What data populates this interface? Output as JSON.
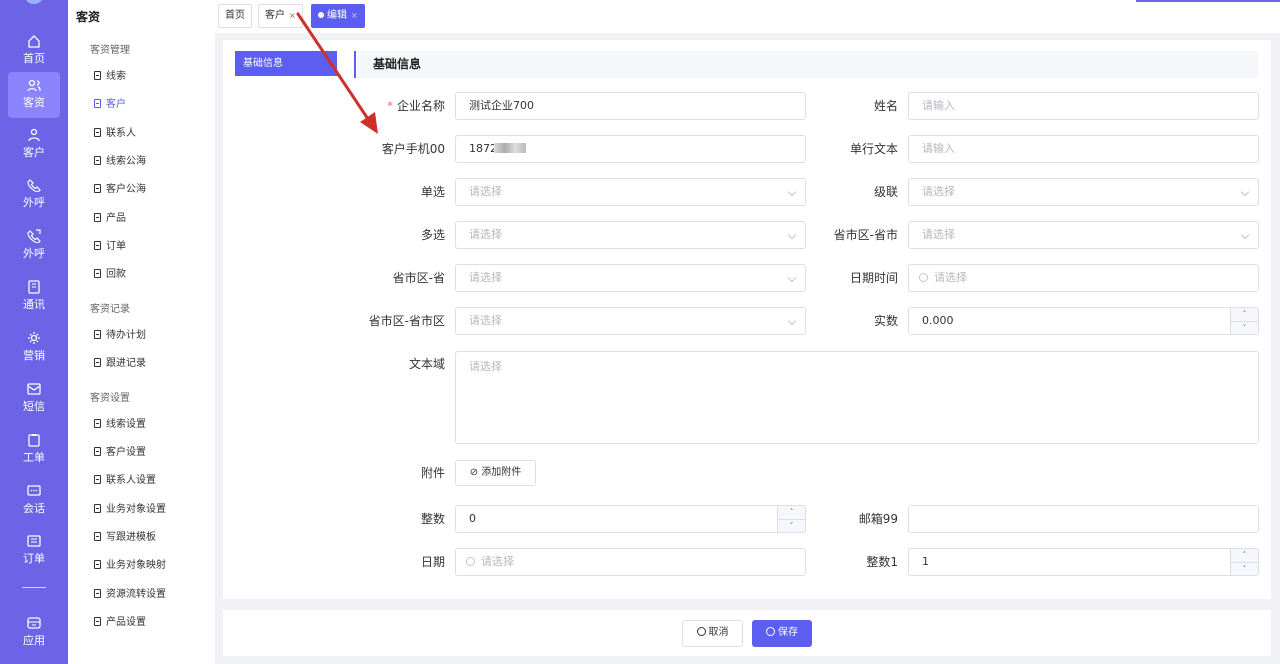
{
  "rail": {
    "items": [
      {
        "label": "首页",
        "icon": "home-icon"
      },
      {
        "label": "客资",
        "icon": "users-icon",
        "active": true
      },
      {
        "label": "客户",
        "icon": "user-icon"
      },
      {
        "label": "外呼",
        "icon": "phone-out-icon"
      },
      {
        "label": "外呼",
        "icon": "phone-call-icon"
      },
      {
        "label": "通讯",
        "icon": "contacts-icon"
      },
      {
        "label": "营销",
        "icon": "gear-icon"
      },
      {
        "label": "短信",
        "icon": "message-icon"
      },
      {
        "label": "工单",
        "icon": "clipboard-icon"
      },
      {
        "label": "会话",
        "icon": "chat-icon"
      },
      {
        "label": "订单",
        "icon": "order-icon"
      },
      {
        "label": "应用",
        "icon": "app-icon"
      }
    ]
  },
  "nav": {
    "title": "客资",
    "groups": [
      {
        "label": "客资管理"
      },
      {
        "label": "客资记录"
      },
      {
        "label": "客资设置"
      }
    ],
    "links": [
      "线索",
      "客户",
      "联系人",
      "线索公海",
      "客户公海",
      "产品",
      "订单",
      "回款",
      "待办计划",
      "跟进记录",
      "线索设置",
      "客户设置",
      "联系人设置",
      "业务对象设置",
      "写跟进模板",
      "业务对象映射",
      "资源流转设置",
      "产品设置"
    ],
    "active_link": "客户"
  },
  "tabs": [
    {
      "label": "首页"
    },
    {
      "label": "客户",
      "close": "×"
    },
    {
      "label": "编辑",
      "close": "×"
    }
  ],
  "anchor": {
    "label": "基础信息"
  },
  "section": {
    "title": "基础信息"
  },
  "form": {
    "company": {
      "label": "企业名称",
      "required": "*",
      "value": "测试企业700"
    },
    "name": {
      "label": "姓名",
      "placeholder": "请输入"
    },
    "phone": {
      "label": "客户手机00",
      "value": "1872"
    },
    "single_text": {
      "label": "单行文本",
      "placeholder": "请输入"
    },
    "radio": {
      "label": "单选",
      "placeholder": "请选择"
    },
    "cascade": {
      "label": "级联",
      "placeholder": "请选择"
    },
    "multi": {
      "label": "多选",
      "placeholder": "请选择"
    },
    "pc_city": {
      "label": "省市区-省市",
      "placeholder": "请选择"
    },
    "pc_prov": {
      "label": "省市区-省",
      "placeholder": "请选择"
    },
    "datetime": {
      "label": "日期时间",
      "placeholder": "请选择"
    },
    "pc_full": {
      "label": "省市区-省市区",
      "placeholder": "请选择"
    },
    "real": {
      "label": "实数",
      "value": "0.000"
    },
    "textarea": {
      "label": "文本域",
      "placeholder": "请选择"
    },
    "attach": {
      "label": "附件",
      "button": "添加附件"
    },
    "integer": {
      "label": "整数",
      "value": "0"
    },
    "email": {
      "label": "邮箱99",
      "value": ""
    },
    "date": {
      "label": "日期",
      "placeholder": "请选择"
    },
    "integer1": {
      "label": "整数1",
      "value": "1"
    }
  },
  "footer": {
    "cancel": "取消",
    "save": "保存"
  },
  "stepper": {
    "up": "˄",
    "down": "˅"
  },
  "colors": {
    "accent": "#5b5ef0",
    "rail": "#6c63e6",
    "annotation_arrow": "#d0302a"
  }
}
